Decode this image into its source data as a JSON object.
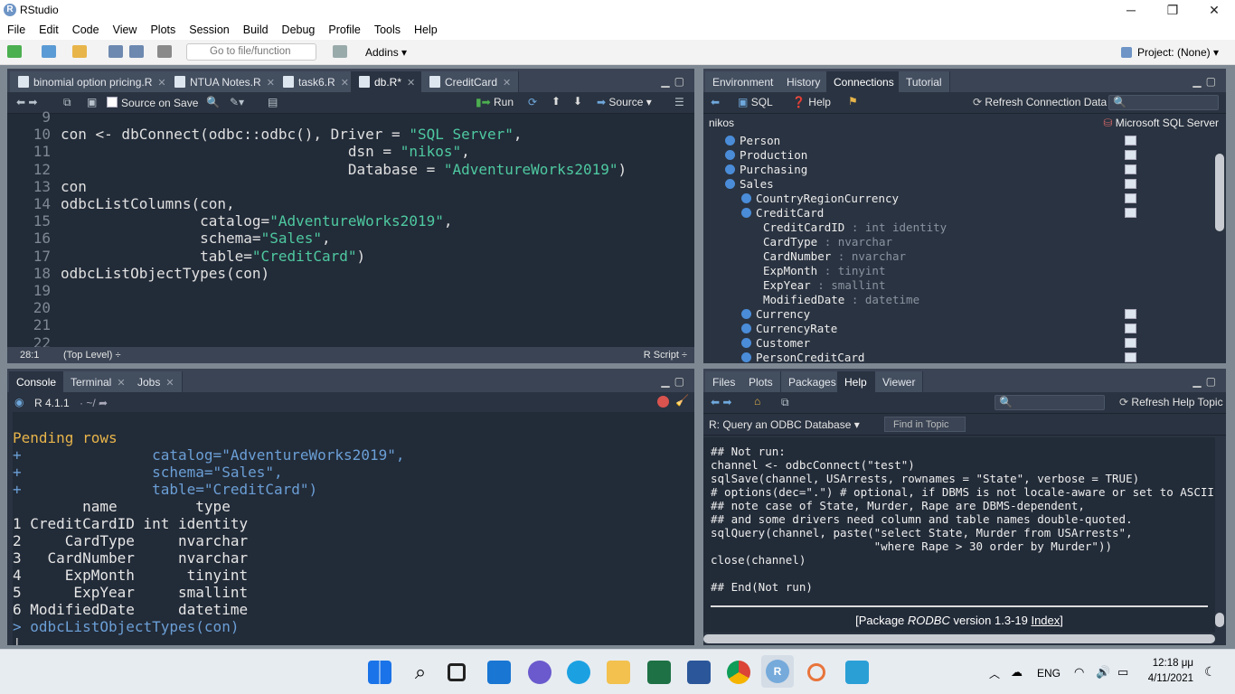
{
  "window": {
    "title": "RStudio",
    "minimize": "─",
    "restore": "❐",
    "close": "✕"
  },
  "menu": [
    "File",
    "Edit",
    "Code",
    "View",
    "Plots",
    "Session",
    "Build",
    "Debug",
    "Profile",
    "Tools",
    "Help"
  ],
  "toolbar": {
    "goto_placeholder": "Go to file/function",
    "addins": "Addins",
    "project": "Project: (None)"
  },
  "source": {
    "tabs": [
      {
        "label": "binomial option pricing.R"
      },
      {
        "label": "NTUA Notes.R"
      },
      {
        "label": "task6.R"
      },
      {
        "label": "db.R*",
        "active": true
      },
      {
        "label": "CreditCard"
      }
    ],
    "source_on_save": "Source on Save",
    "run": "Run",
    "source_btn": "Source",
    "lines": [
      {
        "n": "9",
        "text": ""
      },
      {
        "n": "10",
        "text": "con <- dbConnect(odbc::odbc(), Driver = \"SQL Server\","
      },
      {
        "n": "11",
        "text": "                                 dsn = \"nikos\","
      },
      {
        "n": "12",
        "text": "                                 Database = \"AdventureWorks2019\")"
      },
      {
        "n": "13",
        "text": "con"
      },
      {
        "n": "14",
        "text": "odbcListColumns(con,"
      },
      {
        "n": "15",
        "text": "                catalog=\"AdventureWorks2019\","
      },
      {
        "n": "16",
        "text": "                schema=\"Sales\","
      },
      {
        "n": "17",
        "text": "                table=\"CreditCard\")"
      },
      {
        "n": "18",
        "text": "odbcListObjectTypes(con)"
      },
      {
        "n": "19",
        "text": ""
      },
      {
        "n": "20",
        "text": ""
      },
      {
        "n": "21",
        "text": ""
      },
      {
        "n": "22",
        "text": ""
      }
    ],
    "status_pos": "28:1",
    "status_scope": "(Top Level) ÷",
    "status_type": "R Script ÷"
  },
  "env": {
    "tabs": [
      "Environment",
      "History",
      "Connections",
      "Tutorial"
    ],
    "active_tab": "Connections",
    "sql": "SQL",
    "help": "Help",
    "refresh": "Refresh Connection Data",
    "connection": "nikos",
    "driver": "Microsoft SQL Server",
    "schemas": [
      "Person",
      "Production",
      "Purchasing",
      "Sales"
    ],
    "tables_top": [
      "CountryRegionCurrency",
      "CreditCard"
    ],
    "columns": [
      {
        "name": "CreditCardID",
        "type": "int identity"
      },
      {
        "name": "CardType",
        "type": "nvarchar"
      },
      {
        "name": "CardNumber",
        "type": "nvarchar"
      },
      {
        "name": "ExpMonth",
        "type": "tinyint"
      },
      {
        "name": "ExpYear",
        "type": "smallint"
      },
      {
        "name": "ModifiedDate",
        "type": "datetime"
      }
    ],
    "tables_bottom": [
      "Currency",
      "CurrencyRate",
      "Customer",
      "PersonCreditCard"
    ]
  },
  "console": {
    "tabs": [
      "Console",
      "Terminal",
      "Jobs"
    ],
    "version": "R 4.1.1",
    "path": "~/",
    "pending": "Pending rows",
    "cont": [
      "              catalog=\"AdventureWorks2019\",",
      "              schema=\"Sales\",",
      "              table=\"CreditCard\")"
    ],
    "header": "        name         type",
    "rows": [
      "1 CreditCardID int identity",
      "2     CardType     nvarchar",
      "3   CardNumber     nvarchar",
      "4     ExpMonth      tinyint",
      "5      ExpYear     smallint",
      "6 ModifiedDate     datetime"
    ],
    "last": "odbcListObjectTypes(con)"
  },
  "help": {
    "tabs": [
      "Files",
      "Plots",
      "Packages",
      "Help",
      "Viewer"
    ],
    "active_tab": "Help",
    "refresh": "Refresh Help Topic",
    "topic": "R: Query an ODBC Database",
    "find": "Find in Topic",
    "lines": [
      "## Not run:",
      "channel <- odbcConnect(\"test\")",
      "sqlSave(channel, USArrests, rownames = \"State\", verbose = TRUE)",
      "# options(dec=\".\") # optional, if DBMS is not locale-aware or set to ASCII",
      "## note case of State, Murder, Rape are DBMS-dependent,",
      "## and some drivers need column and table names double-quoted.",
      "sqlQuery(channel, paste(\"select State, Murder from USArrests\",",
      "                        \"where Rape > 30 order by Murder\"))",
      "close(channel)",
      "",
      "## End(Not run)"
    ],
    "pkg_prefix": "[Package ",
    "pkg_name": "RODBC",
    "pkg_version": " version 1.3-19 ",
    "pkg_index": "Index",
    "pkg_suffix": "]"
  },
  "taskbar": {
    "lang": "ENG",
    "time": "12:18 μμ",
    "date": "4/11/2021"
  }
}
